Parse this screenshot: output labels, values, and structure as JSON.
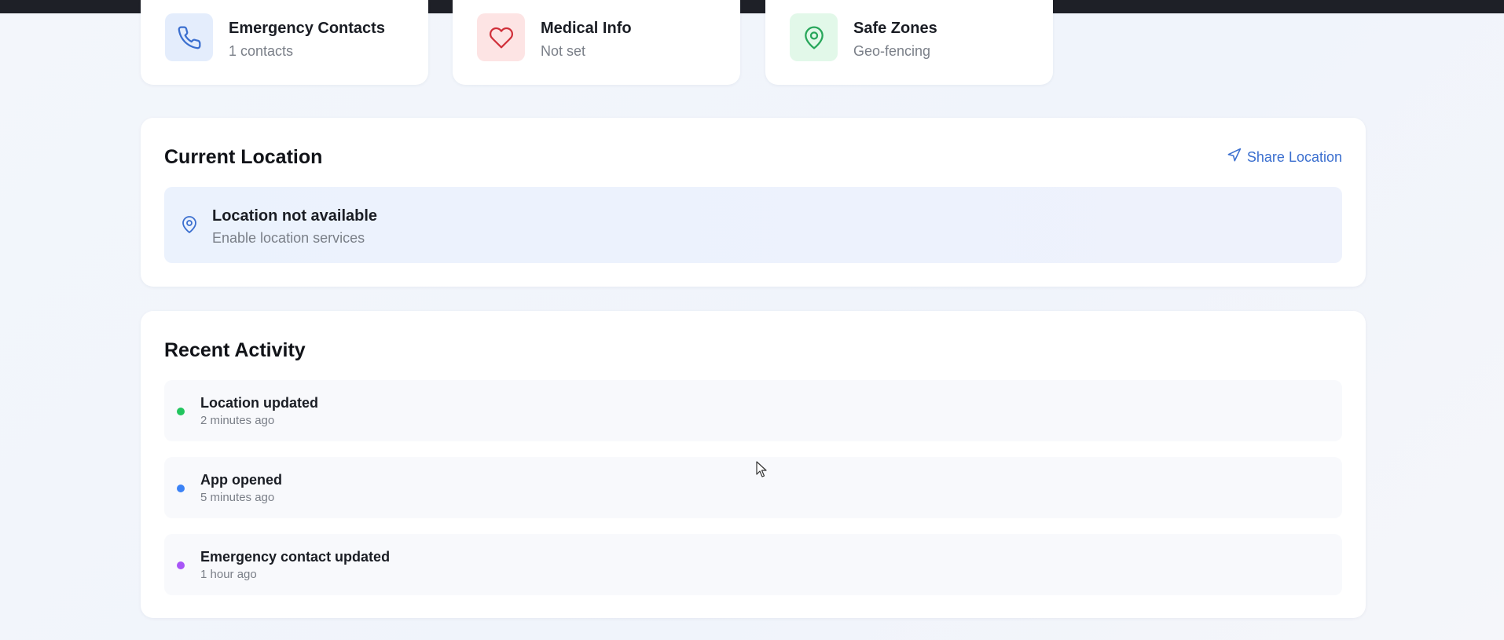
{
  "quick_cards": [
    {
      "title": "Emergency Contacts",
      "subtitle": "1 contacts",
      "icon": "phone-icon",
      "icon_color": "#3b6fcf",
      "bg_color": "#e4edfc"
    },
    {
      "title": "Medical Info",
      "subtitle": "Not set",
      "icon": "heart-icon",
      "icon_color": "#d0303a",
      "bg_color": "#fde4e4"
    },
    {
      "title": "Safe Zones",
      "subtitle": "Geo-fencing",
      "icon": "map-pin-icon",
      "icon_color": "#27a65a",
      "bg_color": "#e2f8e9"
    }
  ],
  "location": {
    "title": "Current Location",
    "share_label": "Share Location",
    "status_title": "Location not available",
    "status_subtitle": "Enable location services"
  },
  "activity": {
    "title": "Recent Activity",
    "items": [
      {
        "title": "Location updated",
        "time": "2 minutes ago",
        "dot_color": "#22c55e"
      },
      {
        "title": "App opened",
        "time": "5 minutes ago",
        "dot_color": "#3b82f6"
      },
      {
        "title": "Emergency contact updated",
        "time": "1 hour ago",
        "dot_color": "#a855f7"
      }
    ]
  },
  "colors": {
    "accent": "#3b6fcf",
    "top_bar": "#1e2027"
  }
}
